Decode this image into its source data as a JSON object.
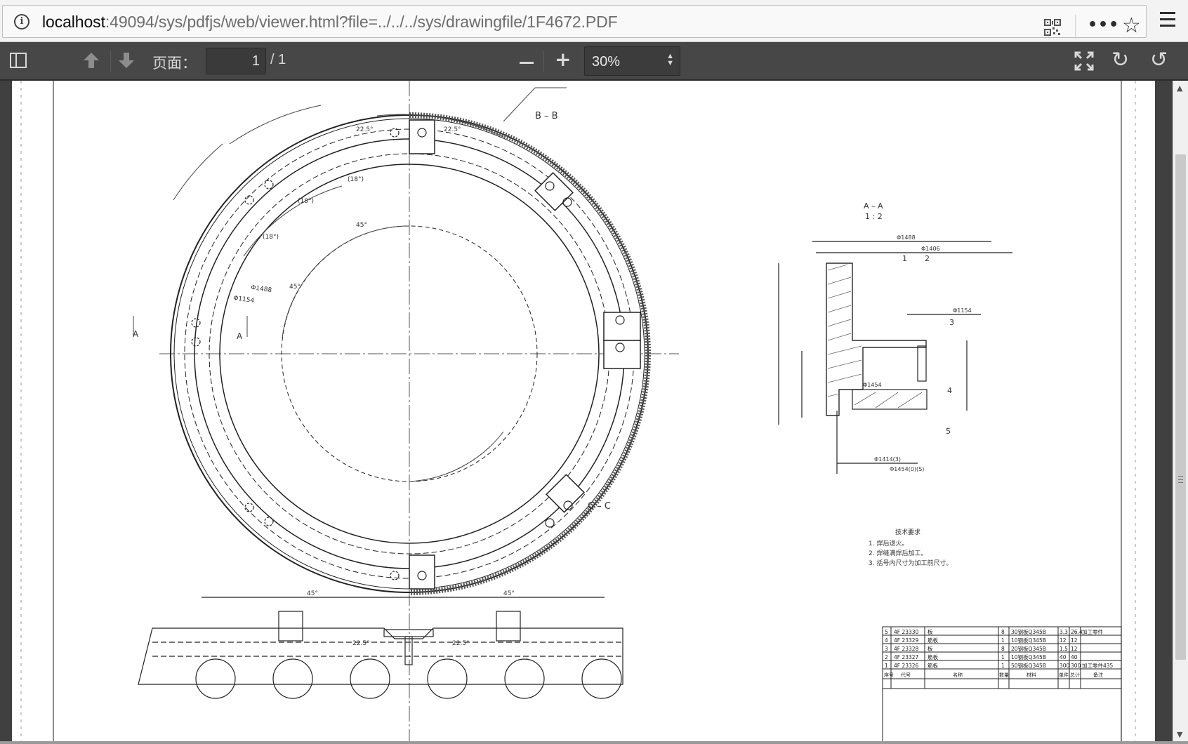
{
  "browser": {
    "url_host": "localhost",
    "url_rest": ":49094/sys/pdfjs/web/viewer.html?file=../../../sys/drawingfile/1F4672.PDF",
    "more_label": "•••"
  },
  "toolbar": {
    "page_label": "页面：",
    "page_number": "1",
    "page_total": "/ 1",
    "zoom_value": "30%"
  },
  "drawing": {
    "section_bb": "B – B",
    "section_aa": "A – A",
    "section_aa_scale": "1 : 2",
    "section_cc": "C – C",
    "cut_mark": "A",
    "tech_title": "技术要求",
    "tech_notes": [
      "1. 焊后退火。",
      "2. 焊缝满焊后加工。",
      "3. 括号内尺寸为加工前尺寸。"
    ],
    "dims": {
      "d1488": "Φ1488",
      "d1406": "Φ1406",
      "d1154": "Φ1154",
      "d1454": "Φ1454",
      "d1414": "Φ1414(3)",
      "d1454b": "Φ1454(0)(S)",
      "angle45": "45°",
      "angle18": "(18°)",
      "angle225": "22.5°"
    },
    "bom_rows": [
      [
        "5",
        "4F 23330",
        "板",
        "8",
        "30钢板Q345B",
        "3.3",
        "26.4",
        "加工零件"
      ],
      [
        "4",
        "4F 23329",
        "筋板",
        "1",
        "10钢板Q345B",
        "12",
        "12",
        ""
      ],
      [
        "3",
        "4F 23328",
        "板",
        "8",
        "20钢板Q345B",
        "1.5",
        "12",
        ""
      ],
      [
        "2",
        "4F 23327",
        "筋板",
        "1",
        "10钢板Q345B",
        "40",
        "40",
        ""
      ],
      [
        "1",
        "4F 23326",
        "筋板",
        "1",
        "50钢板Q345B",
        "300",
        "300",
        "加工零件435"
      ]
    ],
    "bom_header": [
      "序号",
      "代号",
      "名称",
      "数量",
      "材料",
      "单件",
      "总计",
      "备注"
    ]
  }
}
